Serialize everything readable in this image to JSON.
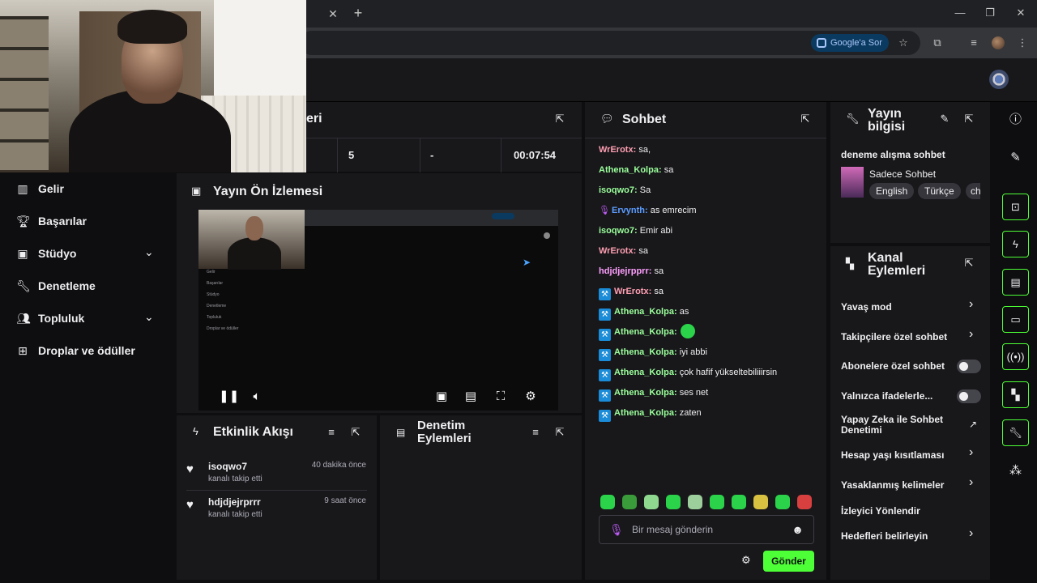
{
  "browser": {
    "lens_label": "Google'a Sor",
    "tab_close": "✕",
    "tab_new": "+",
    "win_min": "—",
    "win_max": "❐",
    "win_close": "✕"
  },
  "left_nav": {
    "items": [
      {
        "label": "Gelir"
      },
      {
        "label": "Başarılar"
      },
      {
        "label": "Stüdyo"
      },
      {
        "label": "Denetleme"
      },
      {
        "label": "Topluluk"
      },
      {
        "label": "Droplar ve ödüller"
      }
    ]
  },
  "stats": {
    "title_fragment": "eri",
    "values": [
      "5",
      "-",
      "00:07:54"
    ]
  },
  "preview": {
    "title": "Yayın Ön İzlemesi",
    "mini_nav": [
      "Gelir",
      "Başarılar",
      "Stüdyo",
      "Denetleme",
      "Topluluk",
      "Droplar ve ödüller"
    ]
  },
  "activity": {
    "title": "Etkinlik Akışı",
    "items": [
      {
        "user": "isoqwo7",
        "action": "kanalı takip etti",
        "time": "40 dakika önce"
      },
      {
        "user": "hdjdjejrprrr",
        "action": "kanalı takip etti",
        "time": "9 saat önce"
      }
    ]
  },
  "mod_actions": {
    "title_line1": "Denetim",
    "title_line2": "Eylemleri"
  },
  "chat": {
    "title": "Sohbet",
    "messages": [
      {
        "user": "WrErotx",
        "text": " sa,",
        "color": "#ff9fb2",
        "badge": ""
      },
      {
        "user": "Athena_Kolpa",
        "text": " sa",
        "color": "#9bff9b",
        "badge": ""
      },
      {
        "user": "isoqwo7",
        "text": " Sa",
        "color": "#9bff9b",
        "badge": ""
      },
      {
        "user": "Ervynth",
        "text": " as emrecim",
        "color": "#5c9cff",
        "badge": "mic"
      },
      {
        "user": "isoqwo7",
        "text": " Emir abi",
        "color": "#9bff9b",
        "badge": ""
      },
      {
        "user": "WrErotx",
        "text": " sa",
        "color": "#ff9fb2",
        "badge": ""
      },
      {
        "user": "hdjdjejrpprr",
        "text": " sa",
        "color": "#ff9fff",
        "badge": ""
      },
      {
        "user": "WrErotx",
        "text": " sa",
        "color": "#ff9fb2",
        "badge": "mod"
      },
      {
        "user": "Athena_Kolpa",
        "text": " as",
        "color": "#9bff9b",
        "badge": "mod"
      },
      {
        "user": "Athena_Kolpa",
        "text": "",
        "color": "#9bff9b",
        "badge": "mod",
        "emote": true
      },
      {
        "user": "Athena_Kolpa",
        "text": " iyi abbi",
        "color": "#9bff9b",
        "badge": "mod"
      },
      {
        "user": "Athena_Kolpa",
        "text": " çok hafif yükseltebiliiirsin",
        "color": "#9bff9b",
        "badge": "mod"
      },
      {
        "user": "Athena_Kolpa",
        "text": " ses net",
        "color": "#9bff9b",
        "badge": "mod"
      },
      {
        "user": "Athena_Kolpa",
        "text": " zaten",
        "color": "#9bff9b",
        "badge": "mod"
      }
    ],
    "input_placeholder": "Bir mesaj gönderin",
    "send_label": "Gönder"
  },
  "stream_info": {
    "title_line1": "Yayın",
    "title_line2": "bilgisi",
    "stream_title": "deneme alışma sohbet",
    "category": "Sadece Sohbet",
    "tags": [
      "English",
      "Türkçe",
      "ch"
    ]
  },
  "channel_actions": {
    "title_line1": "Kanal",
    "title_line2": "Eylemleri",
    "items": [
      {
        "label": "Yavaş mod",
        "control": "chevron"
      },
      {
        "label": "Takipçilere özel sohbet",
        "control": "chevron"
      },
      {
        "label": "Abonelere özel sohbet",
        "control": "toggle"
      },
      {
        "label": "Yalnızca ifadelerle...",
        "control": "toggle"
      },
      {
        "label": "Yapay Zeka ile Sohbet Denetimi",
        "control": "external"
      },
      {
        "label": "Hesap yaşı kısıtlaması",
        "control": "chevron"
      },
      {
        "label": "Yasaklanmış kelimeler",
        "control": "chevron"
      },
      {
        "label": "İzleyici Yönlendir",
        "control": "none"
      },
      {
        "label": "Hedefleri belirleyin",
        "control": "chevron"
      }
    ]
  },
  "colors": {
    "accent_green": "#4dff36",
    "panel_bg": "#18181b",
    "page_bg": "#0e0e10"
  }
}
